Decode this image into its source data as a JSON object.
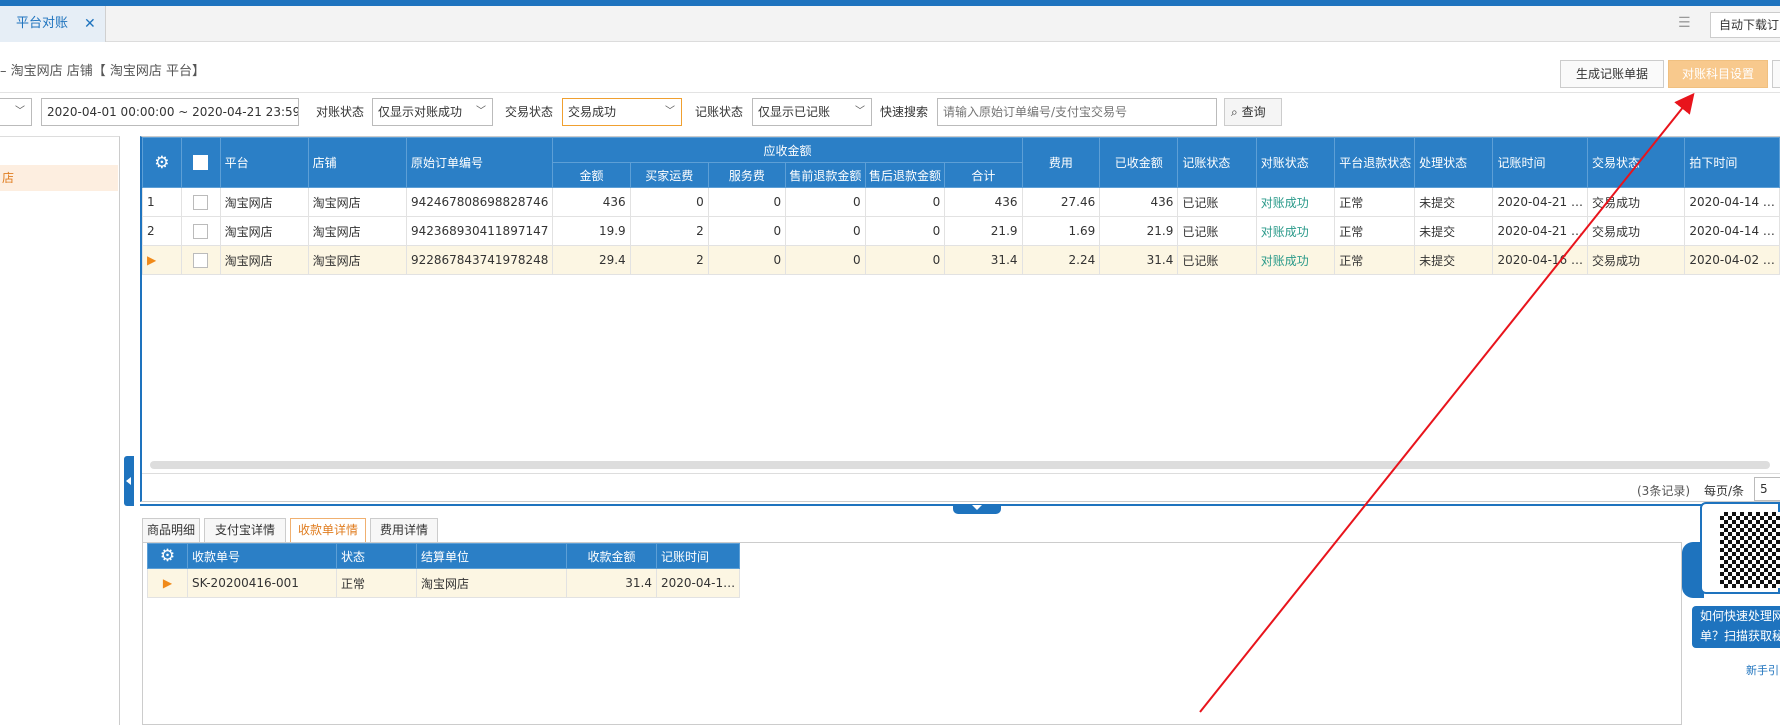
{
  "tabs": {
    "active_label": "平台对账",
    "close_glyph": "✕",
    "auto_download_label": "自动下载订"
  },
  "breadcrumb": "– 淘宝网店 店铺【 淘宝网店 平台】",
  "toolbar": {
    "generate_label": "生成记账单据",
    "subject_settings_label": "对账科目设置"
  },
  "filters": {
    "date_range": "2020-04-01 00:00:00 ~ 2020-04-21 23:59:59",
    "recon_status_label": "对账状态",
    "recon_status_value": "仅显示对账成功",
    "trade_status_label": "交易状态",
    "trade_status_value": "交易成功",
    "booking_status_label": "记账状态",
    "booking_status_value": "仅显示已记账",
    "quick_search_label": "快速搜索",
    "quick_search_placeholder": "请输入原始订单编号/支付宝交易号",
    "query_label": "查询"
  },
  "left_panel": {
    "selected_item": "店"
  },
  "main_table": {
    "group_header": "应收金额",
    "headers": {
      "platform": "平台",
      "shop": "店铺",
      "order_no": "原始订单编号",
      "amount": "金额",
      "freight": "买家运费",
      "service_fee": "服务费",
      "pre_refund": "售前退款金额",
      "post_refund": "售后退款金额",
      "total": "合计",
      "fee": "费用",
      "received": "已收金额",
      "booking_status": "记账状态",
      "recon_status": "对账状态",
      "refund_status": "平台退款状态",
      "process_status": "处理状态",
      "booking_time": "记账时间",
      "trade_status": "交易状态",
      "paid_time": "拍下时间"
    },
    "rows": [
      {
        "idx": "1",
        "platform": "淘宝网店",
        "shop": "淘宝网店",
        "order_no": "942467808698828746",
        "amount": "436",
        "freight": "0",
        "service_fee": "0",
        "pre_refund": "0",
        "post_refund": "0",
        "total": "436",
        "fee": "27.46",
        "received": "436",
        "booking_status": "已记账",
        "recon_status": "对账成功",
        "refund_status": "正常",
        "process_status": "未提交",
        "booking_time": "2020-04-21 …",
        "trade_status": "交易成功",
        "paid_time": "2020-04-14 …"
      },
      {
        "idx": "2",
        "platform": "淘宝网店",
        "shop": "淘宝网店",
        "order_no": "942368930411897147",
        "amount": "19.9",
        "freight": "2",
        "service_fee": "0",
        "pre_refund": "0",
        "post_refund": "0",
        "total": "21.9",
        "fee": "1.69",
        "received": "21.9",
        "booking_status": "已记账",
        "recon_status": "对账成功",
        "refund_status": "正常",
        "process_status": "未提交",
        "booking_time": "2020-04-21 …",
        "trade_status": "交易成功",
        "paid_time": "2020-04-14 …"
      },
      {
        "idx": "▶",
        "platform": "淘宝网店",
        "shop": "淘宝网店",
        "order_no": "922867843741978248",
        "amount": "29.4",
        "freight": "2",
        "service_fee": "0",
        "pre_refund": "0",
        "post_refund": "0",
        "total": "31.4",
        "fee": "2.24",
        "received": "31.4",
        "booking_status": "已记账",
        "recon_status": "对账成功",
        "refund_status": "正常",
        "process_status": "未提交",
        "booking_time": "2020-04-16 …",
        "trade_status": "交易成功",
        "paid_time": "2020-04-02 …"
      }
    ]
  },
  "pager": {
    "records": "(3条记录)",
    "per_page_label": "每页/条",
    "per_page_value": "5"
  },
  "bottom_tabs": [
    "商品明细",
    "支付宝详情",
    "收款单详情",
    "费用详情"
  ],
  "bottom_table": {
    "headers": {
      "receipt_no": "收款单号",
      "status": "状态",
      "unit": "结算单位",
      "amount": "收款金额",
      "time": "记账时间"
    },
    "rows": [
      {
        "idx": "▶",
        "receipt_no": "SK-20200416-001",
        "status": "正常",
        "unit": "淘宝网店",
        "amount": "31.4",
        "time": "2020-04-1…"
      }
    ]
  },
  "qr_promo": {
    "line1": "如何快速处理网",
    "line2": "单？扫描获取秘",
    "link": "新手引"
  },
  "colors": {
    "header_blue": "#2b7fc6",
    "accent_orange": "#e07d20",
    "success_teal": "#2a9a8a",
    "annotation_red": "#e8141c"
  },
  "icons": {
    "settings": "gear-icon",
    "search": "search-icon",
    "list": "list-icon"
  }
}
